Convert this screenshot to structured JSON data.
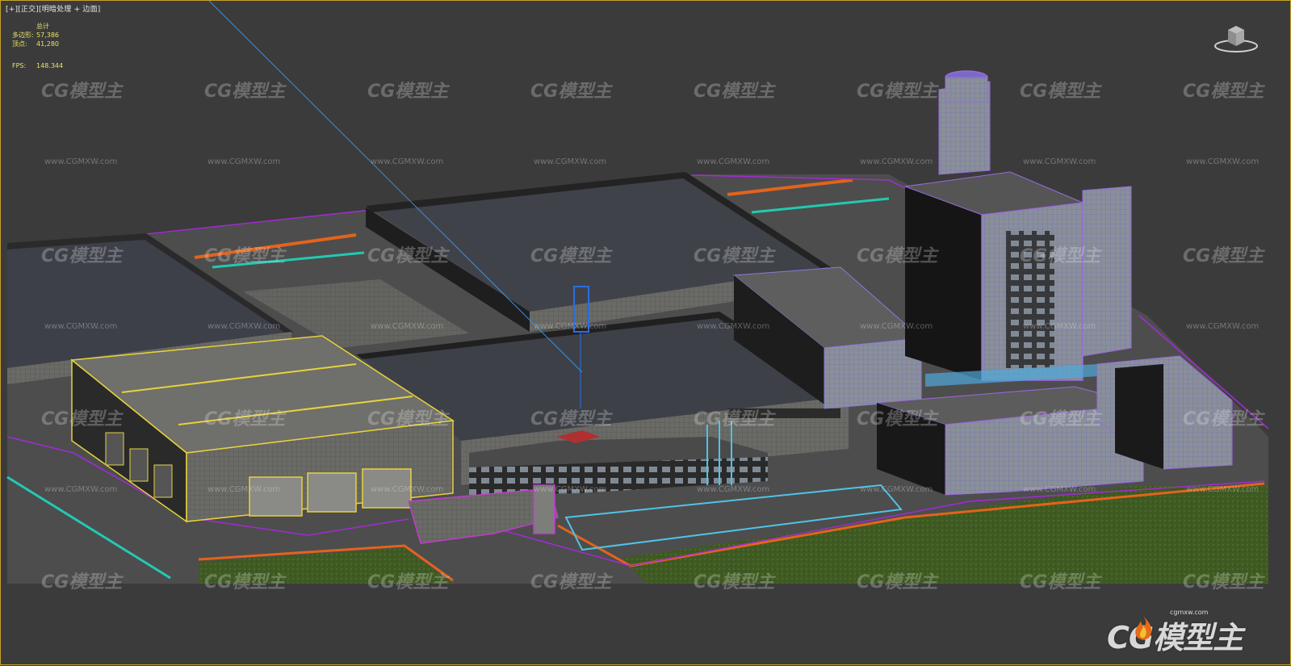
{
  "viewport": {
    "label_plus": "[+]",
    "label_view": "[正交]",
    "label_shading": "[明暗处理 + 边面]"
  },
  "stats": {
    "title": "总计",
    "polys_label": "多边形:",
    "polys_value": "57,386",
    "verts_label": "顶点:",
    "verts_value": "41,280",
    "fps_label": "FPS:",
    "fps_value": "148.344"
  },
  "watermark": {
    "logo_text": "CG模型主",
    "url_text": "www.CGMXW.com"
  },
  "brand": {
    "url": "cgmxw.com",
    "mark": "CG模型主"
  },
  "colors": {
    "viewport_bg": "#3b3b3b",
    "frame": "#c9a227",
    "stats_text": "#e8e26a",
    "selection_yellow": "#e6d23c",
    "spline_purple": "#a32bd6",
    "road_orange": "#e2641c",
    "rail_cyan": "#22c9b3",
    "glass_blue": "#4fc3e8"
  },
  "icons": [
    "viewcube-icon",
    "flame-icon"
  ]
}
